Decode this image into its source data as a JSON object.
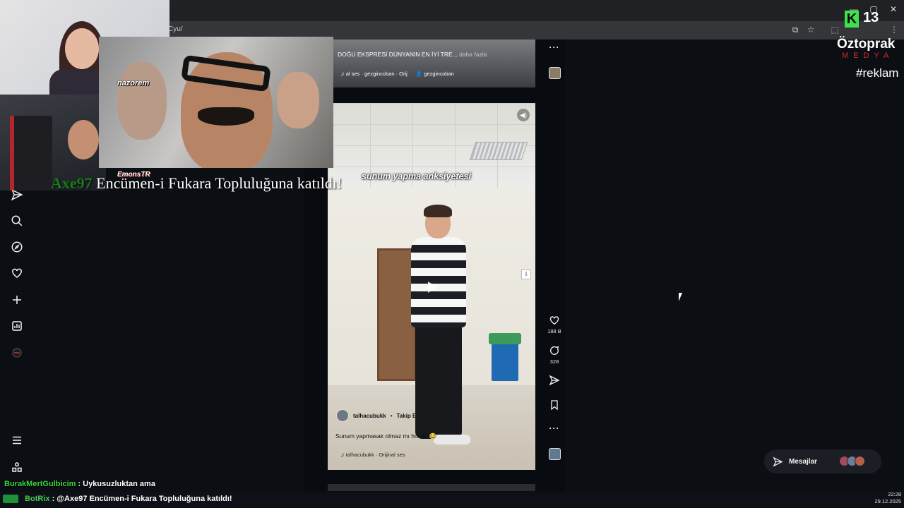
{
  "browser": {
    "url": "Cyu/"
  },
  "sidebar": {
    "items": [
      {
        "name": "messages-send-icon"
      },
      {
        "name": "search-icon"
      },
      {
        "name": "explore-icon"
      },
      {
        "name": "heart-icon"
      },
      {
        "name": "plus-icon"
      },
      {
        "name": "dashboard-icon"
      },
      {
        "name": "profile-avatar-icon"
      },
      {
        "name": "menu-icon"
      },
      {
        "name": "apps-icon"
      }
    ]
  },
  "feed": {
    "top_reel": {
      "caption": "DOĞU EKSPRESİ DÜNYANIN EN İYİ TRE...",
      "more": "daha fazla",
      "audio": "al ses · gezgincoban · Orij",
      "account": "gezgincoban"
    },
    "main_reel": {
      "overlay_text": "sunum yapma anksiyetesi",
      "author": "talhacubukk",
      "separator": "•",
      "follow_label": "Takip Et",
      "caption": "Sunum yapmasak olmaz mı hocam😂",
      "audio": "talhacubukk · Orijinal ses",
      "likes": "188 B",
      "comments": "328"
    }
  },
  "overlays": {
    "meme_tag": "nazorem",
    "emons_tag": "EmonsTR",
    "join_user": "Axe97",
    "join_text": "Encümen-i Fukara Topluluğuna katıldı!"
  },
  "brand": {
    "k_letter": "K",
    "viewer_count": "13",
    "name": "Öztoprak",
    "sub": "MEDYA",
    "tag": "#reklam"
  },
  "messages": {
    "label": "Mesajlar"
  },
  "chat": {
    "line1_user": "BurakMertGulbicim",
    "line1_text": ": Uykusuzluktan ama",
    "line2_user": "BotRix",
    "line2_text": ": @Axe97 Encümen-i Fukara Topluluğuna katıldı!"
  },
  "clock": {
    "time": "22:28",
    "date": "29.12.2025"
  }
}
